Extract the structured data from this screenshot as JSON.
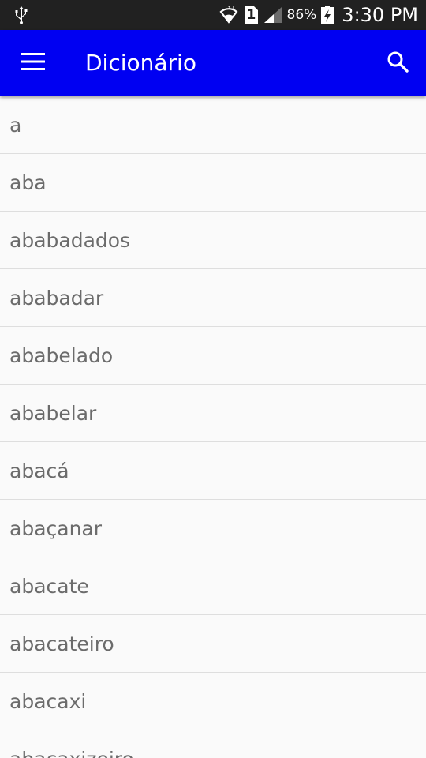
{
  "status_bar": {
    "battery_percent": "86%",
    "time": "3:30 PM",
    "sim_slot": "1",
    "icons": [
      "usb-icon",
      "wifi-icon",
      "sim-icon",
      "signal-icon",
      "battery-charging-icon"
    ]
  },
  "app_bar": {
    "title": "Dicionário",
    "background_color": "#0000f2",
    "menu_icon": "hamburger-menu-icon",
    "search_icon": "search-icon"
  },
  "word_list": {
    "items": [
      "a",
      "aba",
      "ababadados",
      "ababadar",
      "ababelado",
      "ababelar",
      "abacá",
      "abaçanar",
      "abacate",
      "abacateiro",
      "abacaxi",
      "abacaxizeiro"
    ]
  }
}
